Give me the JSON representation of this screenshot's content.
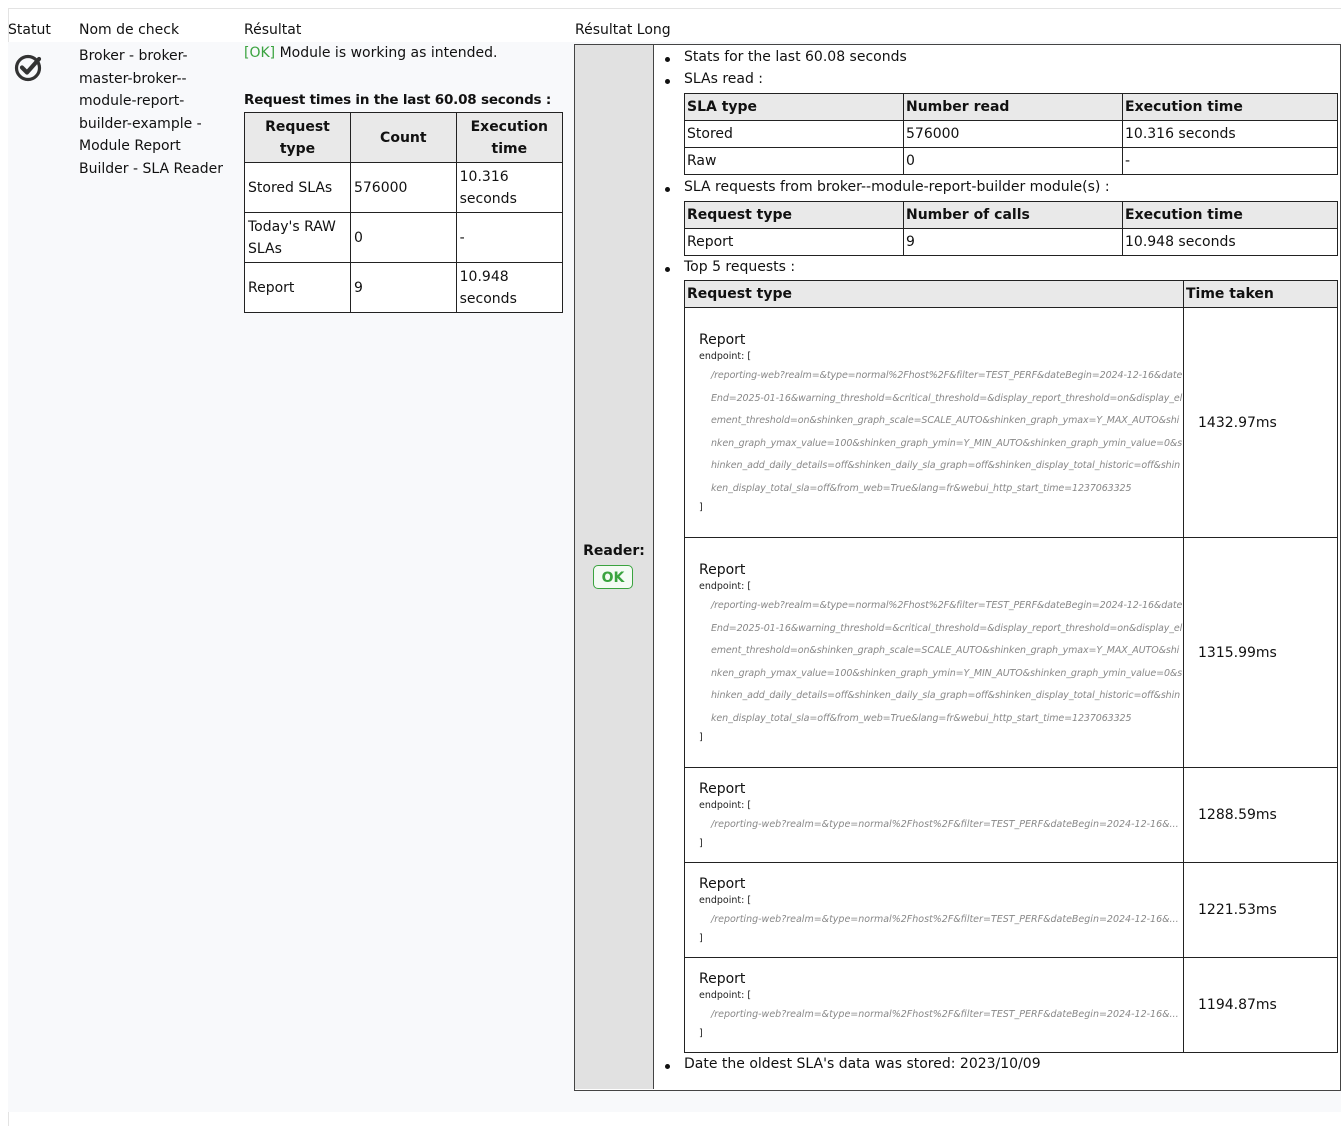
{
  "headers": {
    "statut": "Statut",
    "nom": "Nom de check",
    "resultat": "Résultat",
    "long": "Résultat Long"
  },
  "check": {
    "status_icon": "check-circle-icon",
    "name": "Broker - broker-master-broker--module-report-builder-example - Module Report Builder - SLA Reader"
  },
  "result": {
    "ok_tag": "[OK]",
    "message": "Module is working as intended.",
    "req_title": "Request times in the last 60.08 seconds :",
    "table_headers": [
      "Request type",
      "Count",
      "Execution time"
    ],
    "rows": [
      [
        "Stored SLAs",
        "576000",
        "10.316 seconds"
      ],
      [
        "Today's RAW SLAs",
        "0",
        "-"
      ],
      [
        "Report",
        "9",
        "10.948 seconds"
      ]
    ]
  },
  "long": {
    "reader_label": "Reader:",
    "reader_status": "OK",
    "b1": "Stats for the last 60.08 seconds",
    "b2": "SLAs read :",
    "sla_headers": [
      "SLA type",
      "Number read",
      "Execution time"
    ],
    "sla_rows": [
      [
        "Stored",
        "576000",
        "10.316 seconds"
      ],
      [
        "Raw",
        "0",
        "-"
      ]
    ],
    "b3": "SLA requests from broker--module-report-builder module(s) :",
    "req_headers": [
      "Request type",
      "Number of calls",
      "Execution time"
    ],
    "req_rows": [
      [
        "Report",
        "9",
        "10.948 seconds"
      ]
    ],
    "b4": "Top 5 requests :",
    "top_headers": [
      "Request type",
      "Time taken"
    ],
    "top": [
      {
        "title": "Report",
        "endpoint": "endpoint: [",
        "url": "/reporting-web?realm=&type=normal%2Fhost%2F&filter=TEST_PERF&dateBegin=2024-12-16&dateEnd=2025-01-16&warning_threshold=&critical_threshold=&display_report_threshold=on&display_element_threshold=on&shinken_graph_scale=SCALE_AUTO&shinken_graph_ymax=Y_MAX_AUTO&shinken_graph_ymax_value=100&shinken_graph_ymin=Y_MIN_AUTO&shinken_graph_ymin_value=0&shinken_add_daily_details=off&shinken_daily_sla_graph=off&shinken_display_total_historic=off&shinken_display_total_sla=off&from_web=True&lang=fr&webui_http_start_time=1237063325",
        "close": "]",
        "time": "1432.97ms"
      },
      {
        "title": "Report",
        "endpoint": "endpoint: [",
        "url": "/reporting-web?realm=&type=normal%2Fhost%2F&filter=TEST_PERF&dateBegin=2024-12-16&dateEnd=2025-01-16&warning_threshold=&critical_threshold=&display_report_threshold=on&display_element_threshold=on&shinken_graph_scale=SCALE_AUTO&shinken_graph_ymax=Y_MAX_AUTO&shinken_graph_ymax_value=100&shinken_graph_ymin=Y_MIN_AUTO&shinken_graph_ymin_value=0&shinken_add_daily_details=off&shinken_daily_sla_graph=off&shinken_display_total_historic=off&shinken_display_total_sla=off&from_web=True&lang=fr&webui_http_start_time=1237063325",
        "close": "]",
        "time": "1315.99ms"
      },
      {
        "title": "Report",
        "endpoint": "endpoint: [",
        "url": "/reporting-web?realm=&type=normal%2Fhost%2F&filter=TEST_PERF&dateBegin=2024-12-16&...",
        "close": "]",
        "time": "1288.59ms"
      },
      {
        "title": "Report",
        "endpoint": "endpoint: [",
        "url": "/reporting-web?realm=&type=normal%2Fhost%2F&filter=TEST_PERF&dateBegin=2024-12-16&...",
        "close": "]",
        "time": "1221.53ms"
      },
      {
        "title": "Report",
        "endpoint": "endpoint: [",
        "url": "/reporting-web?realm=&type=normal%2Fhost%2F&filter=TEST_PERF&dateBegin=2024-12-16&...",
        "close": "]",
        "time": "1194.87ms"
      }
    ],
    "b5": "Date the oldest SLA's data was stored: 2023/10/09"
  }
}
